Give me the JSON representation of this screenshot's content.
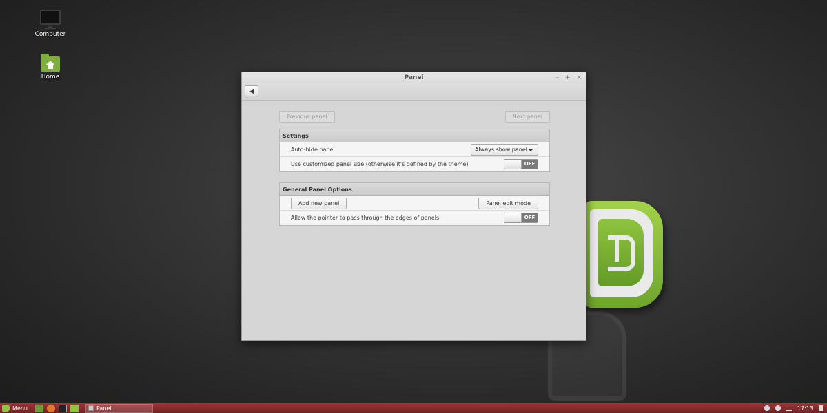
{
  "desktop": {
    "icons": [
      {
        "label": "Computer",
        "icon": "computer-icon"
      },
      {
        "label": "Home",
        "icon": "home-folder-icon"
      }
    ]
  },
  "window": {
    "title": "Panel",
    "controls": {
      "minimize": "–",
      "maximize": "+",
      "close": "×"
    },
    "back_icon": "back-arrow-icon",
    "nav": {
      "previous_label": "Previous panel",
      "next_label": "Next panel"
    },
    "sections": {
      "settings": {
        "title": "Settings",
        "autohide_label": "Auto-hide panel",
        "autohide_value": "Always show panel",
        "custom_size_label": "Use customized panel size (otherwise it's defined by the theme)",
        "custom_size_state": "OFF"
      },
      "general": {
        "title": "General Panel Options",
        "add_panel_label": "Add new panel",
        "edit_mode_label": "Panel edit mode",
        "pointer_label": "Allow the pointer to pass through the edges of panels",
        "pointer_state": "OFF"
      }
    }
  },
  "taskbar": {
    "menu_label": "Menu",
    "task_label": "Panel",
    "clock": "17:13",
    "colors": {
      "bar": "#8b2c2c",
      "accent": "#8cc63f"
    }
  }
}
